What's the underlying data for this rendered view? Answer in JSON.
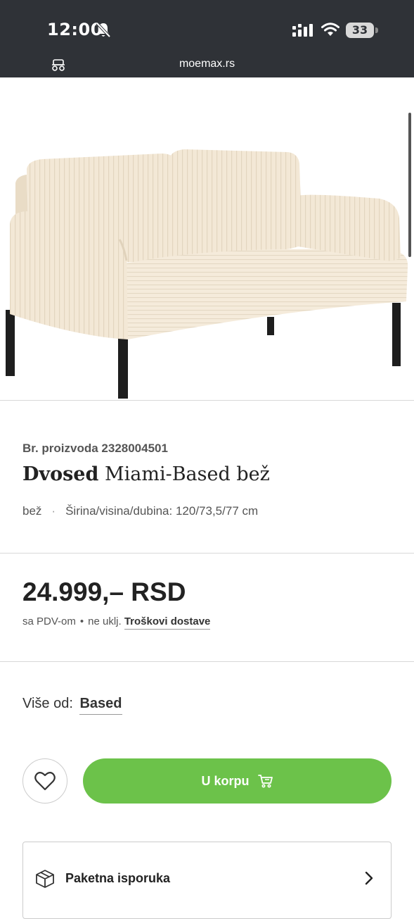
{
  "status_bar": {
    "time": "12:00",
    "battery": "33",
    "url": "moemax.rs"
  },
  "product": {
    "sku_label": "Br. proizvoda 2328004501",
    "title_bold": "Dvosed",
    "title_rest": " Miami-Based bež",
    "color": "bež",
    "dimensions": "Širina/visina/dubina: 120/73,5/77 cm",
    "image_alt": "Dvosed Miami-Based bež"
  },
  "pricing": {
    "price": "24.999,– RSD",
    "tax_note": "sa PDV-om",
    "shipping_prefix": "ne uklj.",
    "shipping_link": "Troškovi dostave"
  },
  "brand": {
    "label": "Više od:",
    "name": "Based"
  },
  "actions": {
    "add_to_cart": "U korpu"
  },
  "delivery": {
    "label": "Paketna isporuka"
  },
  "colors": {
    "status_bar_bg": "#2f3237",
    "cart_button": "#6cc24a",
    "sofa_fabric": "#f3e8d6"
  },
  "icons": [
    "bell-muted-icon",
    "signal-icon",
    "wifi-icon",
    "battery-icon",
    "page-settings-icon",
    "heart-icon",
    "cart-icon",
    "package-icon",
    "chevron-right-icon"
  ]
}
